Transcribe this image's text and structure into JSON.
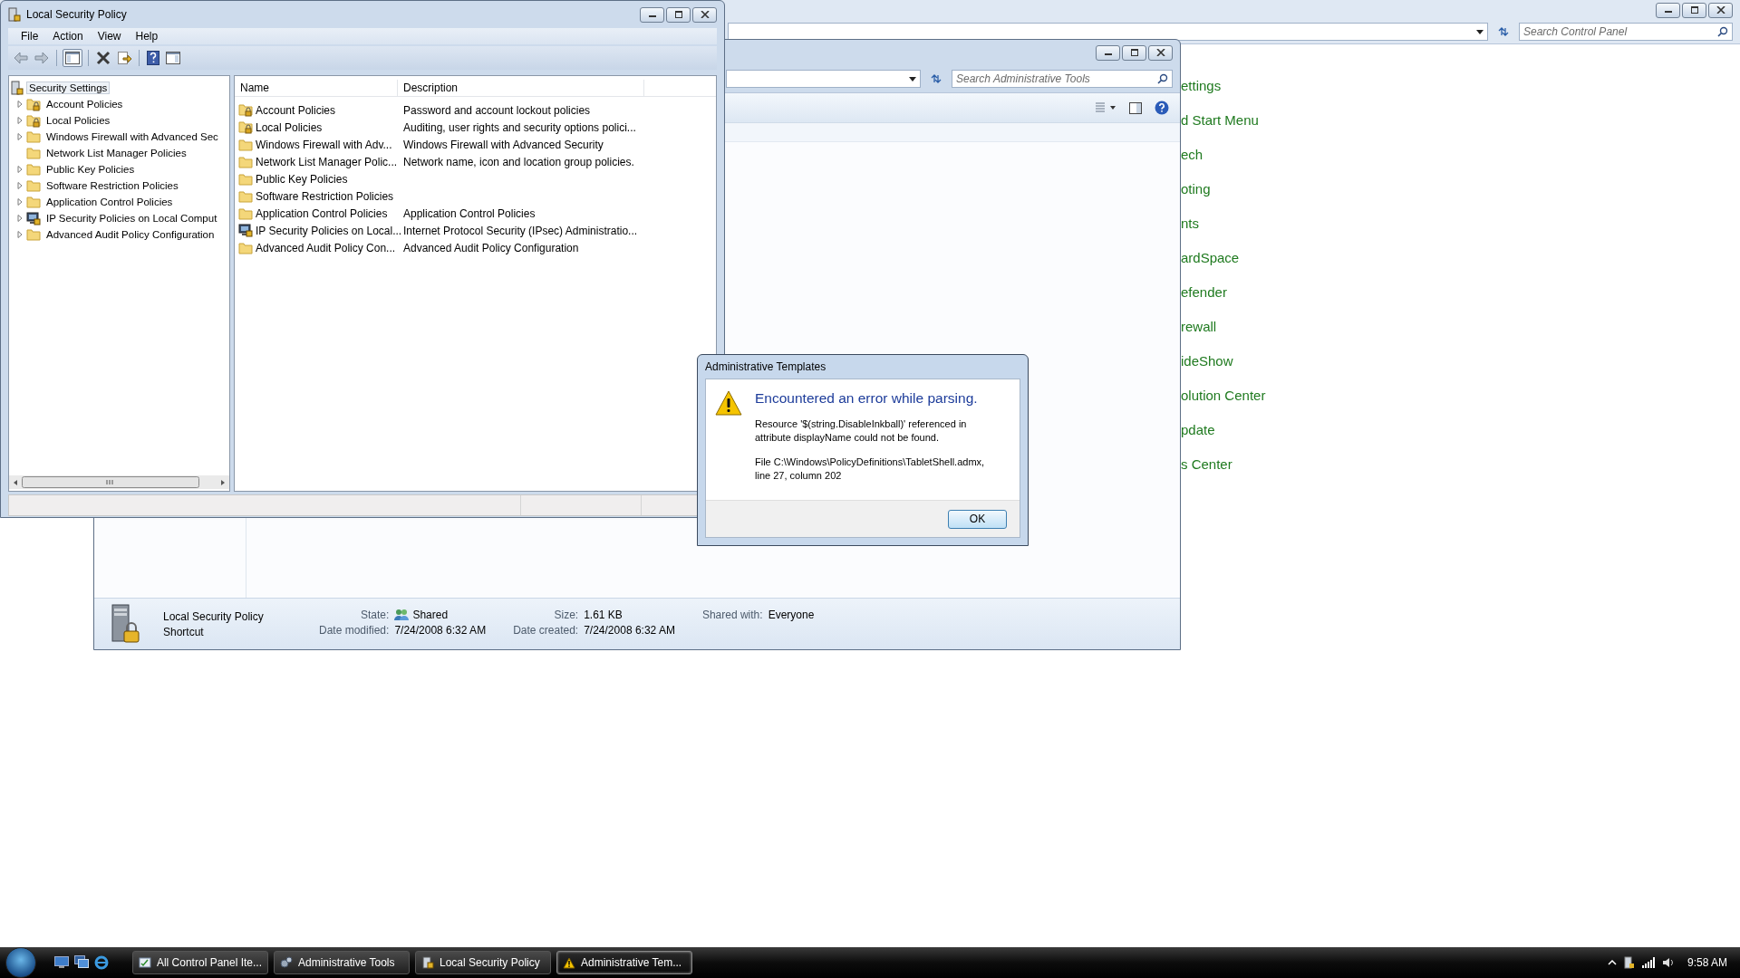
{
  "control_panel": {
    "search": {
      "placeholder": "Search Control Panel"
    },
    "links": [
      "ettings",
      "d Start Menu",
      "ech",
      "oting",
      "nts",
      "ardSpace",
      "efender",
      "rewall",
      "ideShow",
      "olution Center",
      "pdate",
      "s Center"
    ]
  },
  "admin_tools": {
    "search": {
      "placeholder": "Search Administrative Tools"
    },
    "details": {
      "name": "Local Security Policy",
      "type": "Shortcut",
      "columns": [
        [
          {
            "label": "State:",
            "value": "Shared",
            "kind": "shared"
          },
          {
            "label": "Date modified:",
            "value": "7/24/2008 6:32 AM",
            "kind": "plain"
          }
        ],
        [
          {
            "label": "Size:",
            "value": "1.61 KB",
            "kind": "plain"
          },
          {
            "label": "Date created:",
            "value": "7/24/2008 6:32 AM",
            "kind": "plain"
          }
        ],
        [
          {
            "label": "Shared with:",
            "value": "Everyone",
            "kind": "plain"
          }
        ]
      ]
    }
  },
  "security_policy": {
    "window": {
      "title": "Local Security Policy"
    },
    "menu": [
      "File",
      "Action",
      "View",
      "Help"
    ],
    "tree": {
      "label": "Security Settings",
      "selected": true,
      "children": [
        {
          "label": "Account Policies",
          "kind": "locked-folder",
          "expandable": true,
          "selected": false
        },
        {
          "label": "Local Policies",
          "kind": "locked-folder",
          "expandable": true,
          "selected": false
        },
        {
          "label": "Windows Firewall with Advanced Sec",
          "kind": "folder",
          "expandable": true,
          "selected": false
        },
        {
          "label": "Network List Manager Policies",
          "kind": "folder",
          "expandable": false,
          "selected": false
        },
        {
          "label": "Public Key Policies",
          "kind": "folder",
          "expandable": true,
          "selected": false
        },
        {
          "label": "Software Restriction Policies",
          "kind": "folder",
          "expandable": true,
          "selected": false
        },
        {
          "label": "Application Control Policies",
          "kind": "folder",
          "expandable": true,
          "selected": false
        },
        {
          "label": "IP Security Policies on Local Comput",
          "kind": "ipsec",
          "expandable": true,
          "selected": false
        },
        {
          "label": "Advanced Audit Policy Configuration",
          "kind": "folder",
          "expandable": true,
          "selected": false
        }
      ]
    },
    "table": {
      "columns": [
        "Name",
        "Description"
      ],
      "rows": [
        {
          "name": "Account Policies",
          "description": "Password and account lockout policies",
          "kind": "locked-folder"
        },
        {
          "name": "Local Policies",
          "description": "Auditing, user rights and security options polici...",
          "kind": "locked-folder"
        },
        {
          "name": "Windows Firewall with Adv...",
          "description": "Windows Firewall with Advanced Security",
          "kind": "folder"
        },
        {
          "name": "Network List Manager Polic...",
          "description": "Network name, icon and location group policies.",
          "kind": "folder"
        },
        {
          "name": "Public Key Policies",
          "description": "",
          "kind": "folder"
        },
        {
          "name": "Software Restriction Policies",
          "description": "",
          "kind": "folder"
        },
        {
          "name": "Application Control Policies",
          "description": "Application Control Policies",
          "kind": "folder"
        },
        {
          "name": "IP Security Policies on Local...",
          "description": "Internet Protocol Security (IPsec) Administratio...",
          "kind": "ipsec"
        },
        {
          "name": "Advanced Audit Policy Con...",
          "description": "Advanced Audit Policy Configuration",
          "kind": "folder"
        }
      ]
    }
  },
  "dialog": {
    "title": "Administrative Templates",
    "heading": "Encountered an error while parsing.",
    "message": "Resource '$(string.DisableInkball)' referenced in attribute displayName could not be found.",
    "detail": "File C:\\Windows\\PolicyDefinitions\\TabletShell.admx, line 27, column 202",
    "button": "OK"
  },
  "taskbar": {
    "items": [
      {
        "label": "All Control Panel Ite...",
        "kind": "control-panel",
        "selected": false
      },
      {
        "label": "Administrative Tools",
        "kind": "admin-tools",
        "selected": false
      },
      {
        "label": "Local Security Policy",
        "kind": "security",
        "selected": false
      },
      {
        "label": "Administrative Tem...",
        "kind": "warning",
        "selected": true
      }
    ],
    "clock": "9:58 AM"
  }
}
